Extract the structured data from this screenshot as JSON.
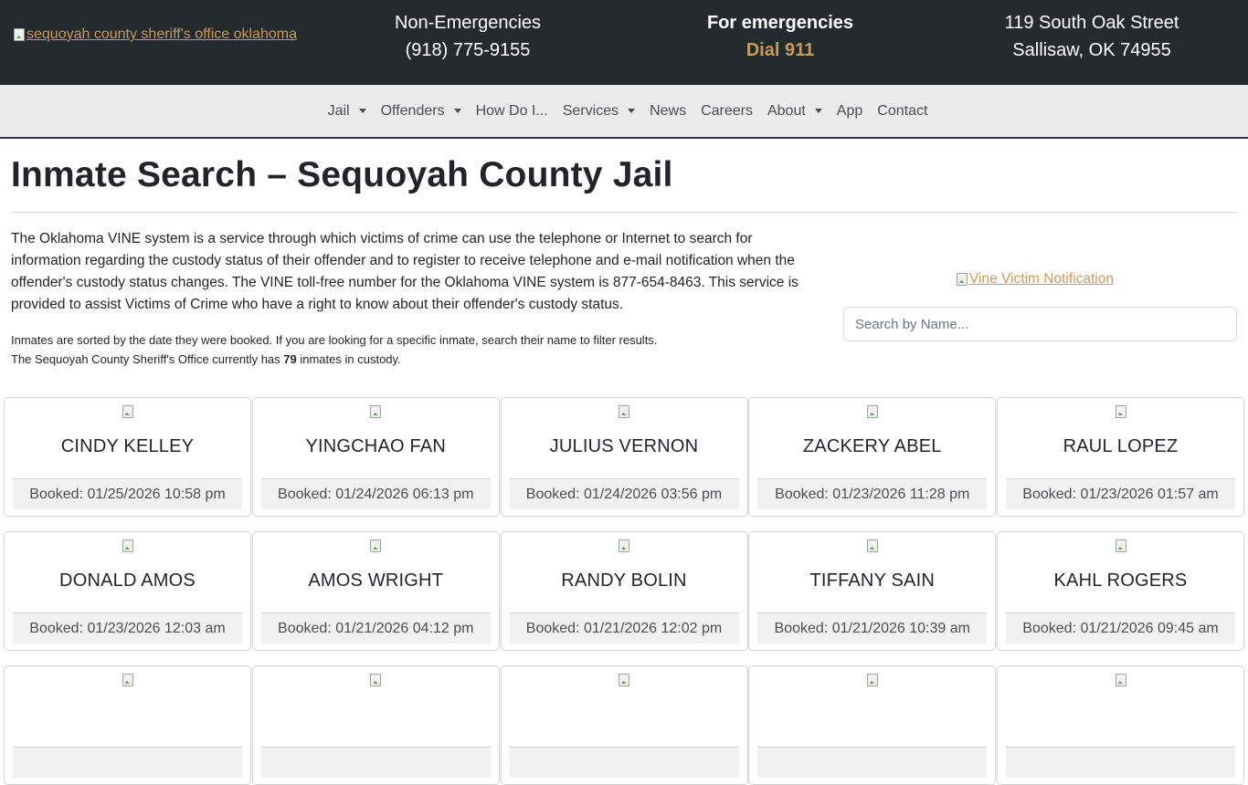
{
  "header": {
    "logo_alt": "sequoyah county sheriff's office oklahoma",
    "non_emergency_label": "Non-Emergencies",
    "non_emergency_phone": "(918) 775-9155",
    "emergency_label": "For emergencies",
    "emergency_action": "Dial 911",
    "address_line1": "119 South Oak Street",
    "address_line2": "Sallisaw, OK 74955"
  },
  "nav": [
    {
      "label": "Jail",
      "dropdown": true
    },
    {
      "label": "Offenders",
      "dropdown": true
    },
    {
      "label": "How Do I...",
      "dropdown": false
    },
    {
      "label": "Services",
      "dropdown": true
    },
    {
      "label": "News",
      "dropdown": false
    },
    {
      "label": "Careers",
      "dropdown": false
    },
    {
      "label": "About",
      "dropdown": true
    },
    {
      "label": "App",
      "dropdown": false
    },
    {
      "label": "Contact",
      "dropdown": false
    }
  ],
  "page": {
    "title": "Inmate Search – Sequoyah County Jail",
    "intro": "The Oklahoma VINE system is a service through which victims of crime can use the telephone or Internet to search for information regarding the custody status of their offender and to register to receive telephone and e-mail notification when the offender's custody status changes. The VINE toll-free number for the Oklahoma VINE system is 877-654-8463. This service is provided to assist Victims of Crime who have a right to know about their offender's custody status.",
    "note_line1": "Inmates are sorted by the date they were booked. If you are looking for a specific inmate, search their name to filter results.",
    "note_line2_prefix": "The Sequoyah County Sheriff's Office currently has ",
    "inmate_count": "79",
    "note_line2_suffix": " inmates in custody.",
    "vine_alt": "Vine Victim Notification",
    "search_placeholder": "Search by Name..."
  },
  "inmates": [
    {
      "name": "CINDY KELLEY",
      "booked": "Booked: 01/25/2026 10:58 pm"
    },
    {
      "name": "YINGCHAO FAN",
      "booked": "Booked: 01/24/2026 06:13 pm"
    },
    {
      "name": "JULIUS VERNON",
      "booked": "Booked: 01/24/2026 03:56 pm"
    },
    {
      "name": "ZACKERY ABEL",
      "booked": "Booked: 01/23/2026 11:28 pm"
    },
    {
      "name": "RAUL LOPEZ",
      "booked": "Booked: 01/23/2026 01:57 am"
    },
    {
      "name": "DONALD AMOS",
      "booked": "Booked: 01/23/2026 12:03 am"
    },
    {
      "name": "AMOS WRIGHT",
      "booked": "Booked: 01/21/2026 04:12 pm"
    },
    {
      "name": "RANDY BOLIN",
      "booked": "Booked: 01/21/2026 12:02 pm"
    },
    {
      "name": "TIFFANY SAIN",
      "booked": "Booked: 01/21/2026 10:39 am"
    },
    {
      "name": "KAHL ROGERS",
      "booked": "Booked: 01/21/2026 09:45 am"
    },
    {
      "name": "",
      "booked": ""
    },
    {
      "name": "",
      "booked": ""
    },
    {
      "name": "",
      "booked": ""
    },
    {
      "name": "",
      "booked": ""
    },
    {
      "name": "",
      "booked": ""
    }
  ]
}
